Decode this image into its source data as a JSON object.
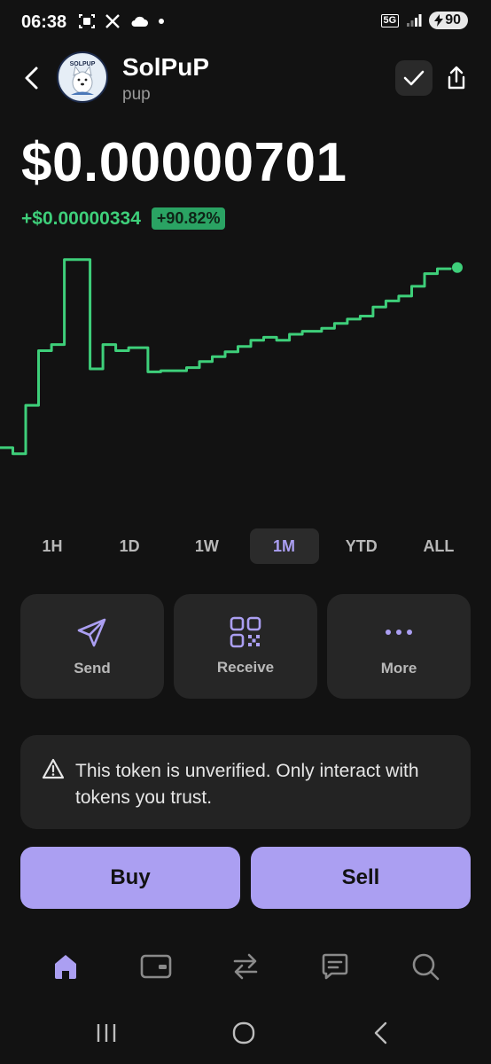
{
  "status_bar": {
    "time": "06:38",
    "network": "5G",
    "battery": "90",
    "icons_left": [
      "screenshot-icon",
      "x-logo-icon",
      "cloud-icon",
      "dot-icon"
    ],
    "icons_right": [
      "network-5g-icon",
      "signal-icon",
      "battery-icon"
    ]
  },
  "header": {
    "token_name": "SolPuP",
    "token_symbol": "pup",
    "logo_text": "SOLPUP"
  },
  "price": {
    "value": "$0.00000701",
    "change_abs": "+$0.00000334",
    "change_pct": "+90.82%"
  },
  "colors": {
    "accent": "#ab9ff2",
    "positive": "#3ecf7a",
    "background": "#121212",
    "card": "#262626"
  },
  "chart_data": {
    "type": "line",
    "x": [
      0,
      1,
      2,
      3,
      4,
      5,
      6,
      7,
      8,
      9,
      10,
      11,
      12,
      13,
      14,
      15,
      16,
      17,
      18,
      19,
      20,
      21,
      22,
      23,
      24,
      25,
      26,
      27,
      28,
      29,
      30,
      31,
      32,
      33,
      34,
      35,
      36,
      37,
      38,
      39,
      40,
      41,
      42,
      43,
      44,
      45,
      46,
      47,
      48,
      49,
      50,
      51,
      52,
      53,
      54,
      55,
      56,
      57,
      58,
      59,
      60,
      61,
      62,
      63,
      64,
      65,
      66,
      67,
      68,
      69,
      70
    ],
    "values": [
      3.6,
      3.6,
      3.5,
      3.5,
      4.3,
      4.3,
      5.2,
      5.2,
      5.3,
      5.3,
      6.7,
      6.7,
      6.7,
      6.7,
      4.9,
      4.9,
      5.3,
      5.3,
      5.2,
      5.2,
      5.25,
      5.25,
      5.25,
      4.85,
      4.85,
      4.87,
      4.87,
      4.87,
      4.87,
      4.92,
      4.92,
      5.02,
      5.02,
      5.1,
      5.1,
      5.18,
      5.18,
      5.27,
      5.27,
      5.37,
      5.37,
      5.42,
      5.42,
      5.37,
      5.37,
      5.47,
      5.47,
      5.52,
      5.52,
      5.52,
      5.57,
      5.57,
      5.65,
      5.65,
      5.72,
      5.72,
      5.77,
      5.77,
      5.92,
      5.92,
      6.02,
      6.02,
      6.1,
      6.1,
      6.26,
      6.26,
      6.47,
      6.47,
      6.55,
      6.55,
      6.57
    ],
    "xlim": [
      0,
      70
    ],
    "ylim": [
      3.0,
      6.8
    ],
    "color": "#3ecf7a",
    "grid": false,
    "legend": "none"
  },
  "ranges": [
    {
      "label": "1H",
      "active": false
    },
    {
      "label": "1D",
      "active": false
    },
    {
      "label": "1W",
      "active": false
    },
    {
      "label": "1M",
      "active": true
    },
    {
      "label": "YTD",
      "active": false
    },
    {
      "label": "ALL",
      "active": false
    }
  ],
  "actions": [
    {
      "label": "Send",
      "icon": "send-icon"
    },
    {
      "label": "Receive",
      "icon": "qr-code-icon"
    },
    {
      "label": "More",
      "icon": "more-dots-icon"
    }
  ],
  "warning": {
    "text": "This token is unverified. Only interact with tokens you trust.",
    "icon": "warning-icon"
  },
  "trade": {
    "buy_label": "Buy",
    "sell_label": "Sell"
  },
  "nav": {
    "items": [
      "home-icon",
      "wallet-card-icon",
      "swap-icon",
      "chat-icon",
      "search-icon"
    ],
    "active": "home-icon"
  },
  "system_nav": [
    "recent-apps-icon",
    "home-circle-icon",
    "back-chevron-icon"
  ]
}
